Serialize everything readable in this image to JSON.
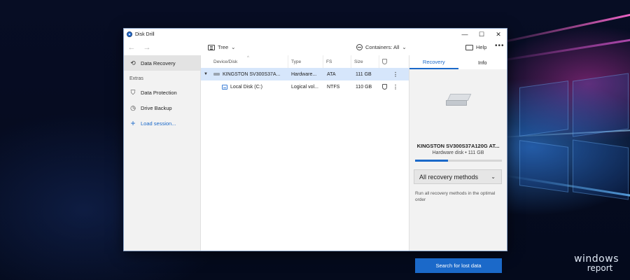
{
  "window": {
    "title": "Disk Drill",
    "controls": {
      "minimize": "—",
      "maximize": "☐",
      "close": "✕"
    }
  },
  "toolbar": {
    "back": "←",
    "forward": "→",
    "view_label": "Tree",
    "view_caret": "⌄",
    "containers_label": "Containers: All",
    "containers_caret": "⌄",
    "help_label": "Help",
    "more": "•••"
  },
  "sidebar": {
    "items": [
      {
        "label": "Data Recovery",
        "active": true,
        "icon": "history-icon"
      }
    ],
    "section_extras": "Extras",
    "extras": [
      {
        "label": "Data Protection",
        "icon": "shield-check-icon"
      },
      {
        "label": "Drive Backup",
        "icon": "clock-backup-icon"
      },
      {
        "label": "Load session...",
        "icon": "plus-icon"
      }
    ]
  },
  "table": {
    "columns": [
      "Device/Disk",
      "Type",
      "FS",
      "Size"
    ],
    "rows": [
      {
        "name": "KINGSTON SV300S37A...",
        "type": "Hardware...",
        "fs": "ATA",
        "size": "111 GB",
        "expanded": true,
        "selected": true
      },
      {
        "name": "Local Disk (C:)",
        "type": "Logical vol...",
        "fs": "NTFS",
        "size": "110 GB",
        "expanded": false,
        "selected": false
      }
    ]
  },
  "right_panel": {
    "tabs": [
      "Recovery",
      "Info"
    ],
    "active_tab": "Recovery",
    "drive_name": "KINGSTON SV300S37A120G AT...",
    "drive_sub": "Hardware disk • 111 GB",
    "usage_fraction": 0.38,
    "method": "All recovery methods",
    "method_caret": "⌄",
    "method_desc": "Run all recovery methods in the optimal order",
    "search_button": "Search for lost data"
  },
  "watermark": {
    "line1": "windows",
    "line2": "report"
  },
  "colors": {
    "accent": "#1b69c9",
    "selected_row": "#d6e6fb",
    "sidebar_bg": "#f2f2f2"
  }
}
